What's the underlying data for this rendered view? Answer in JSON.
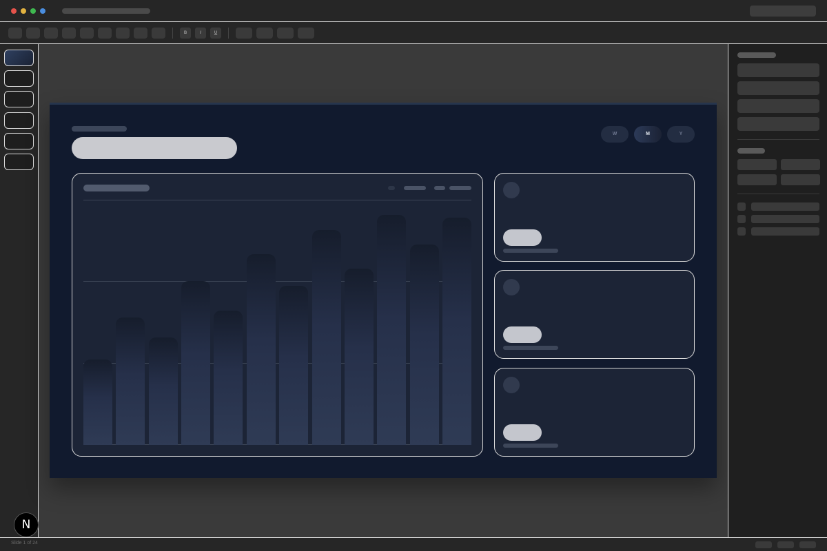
{
  "window": {
    "traffic_lights": [
      {
        "name": "close",
        "color": "#e5534b"
      },
      {
        "name": "minimize",
        "color": "#e3b341"
      },
      {
        "name": "zoom",
        "color": "#3fb950"
      },
      {
        "name": "extra",
        "color": "#4a8ee0"
      }
    ]
  },
  "toolbar": {
    "format_buttons": [
      {
        "label": "B",
        "style": "bold"
      },
      {
        "label": "I",
        "style": "italic"
      },
      {
        "label": "U",
        "style": "underline"
      }
    ]
  },
  "slides": {
    "count": 6,
    "active_index": 0
  },
  "slide": {
    "segments": [
      {
        "label": "W",
        "active": false
      },
      {
        "label": "M",
        "active": true
      },
      {
        "label": "Y",
        "active": false
      }
    ],
    "chart_data": {
      "type": "bar",
      "bar_count": 12,
      "values": [
        35,
        52,
        44,
        67,
        55,
        78,
        65,
        88,
        72,
        94,
        82,
        93
      ],
      "ylim": [
        0,
        100
      ],
      "grid": true
    },
    "kpi_cards": 3
  },
  "statusbar": {
    "text": "Slide 1 of 24"
  },
  "logo": {
    "letter": "N"
  },
  "colors": {
    "slide_background": "#111a2e",
    "card_background": "#1c2436",
    "canvas_background": "#3a3a3a",
    "accent_border": "#d9d9d9"
  }
}
